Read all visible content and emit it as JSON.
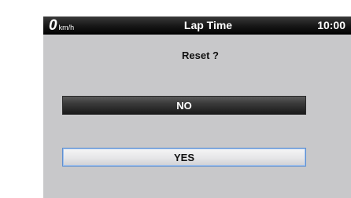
{
  "status_bar": {
    "speed_value": "0",
    "speed_unit": "km/h",
    "title": "Lap Time",
    "clock": "10:00"
  },
  "dialog": {
    "prompt": "Reset ?",
    "no_label": "NO",
    "yes_label": "YES"
  },
  "colors": {
    "screen_background": "#c8c8ca",
    "status_bar_background": "#000000",
    "no_button_background": "#2b2b2b",
    "yes_button_background": "#ececee",
    "yes_button_focus_border": "#5e8fd0"
  }
}
